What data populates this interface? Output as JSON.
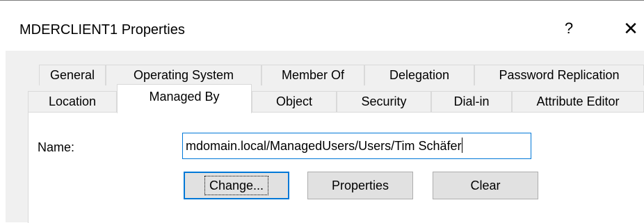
{
  "window": {
    "title": "MDERCLIENT1 Properties",
    "help_label": "?",
    "close_label": "✕"
  },
  "tabs": {
    "row_back": [
      {
        "label": "General"
      },
      {
        "label": "Operating System"
      },
      {
        "label": "Member Of"
      },
      {
        "label": "Delegation"
      },
      {
        "label": "Password Replication"
      }
    ],
    "row_front": [
      {
        "label": "Location"
      },
      {
        "label": "Managed By"
      },
      {
        "label": "Object"
      },
      {
        "label": "Security"
      },
      {
        "label": "Dial-in"
      },
      {
        "label": "Attribute Editor"
      }
    ],
    "active": "Managed By"
  },
  "managed_by": {
    "name_label": "Name:",
    "name_value": "mdomain.local/ManagedUsers/Users/Tim Schäfer",
    "change_label": "Change...",
    "properties_label": "Properties",
    "clear_label": "Clear"
  },
  "colors": {
    "focus_blue": "#0078d7",
    "dialog_bg": "#f0f0f0",
    "button_bg": "#e1e1e1"
  }
}
